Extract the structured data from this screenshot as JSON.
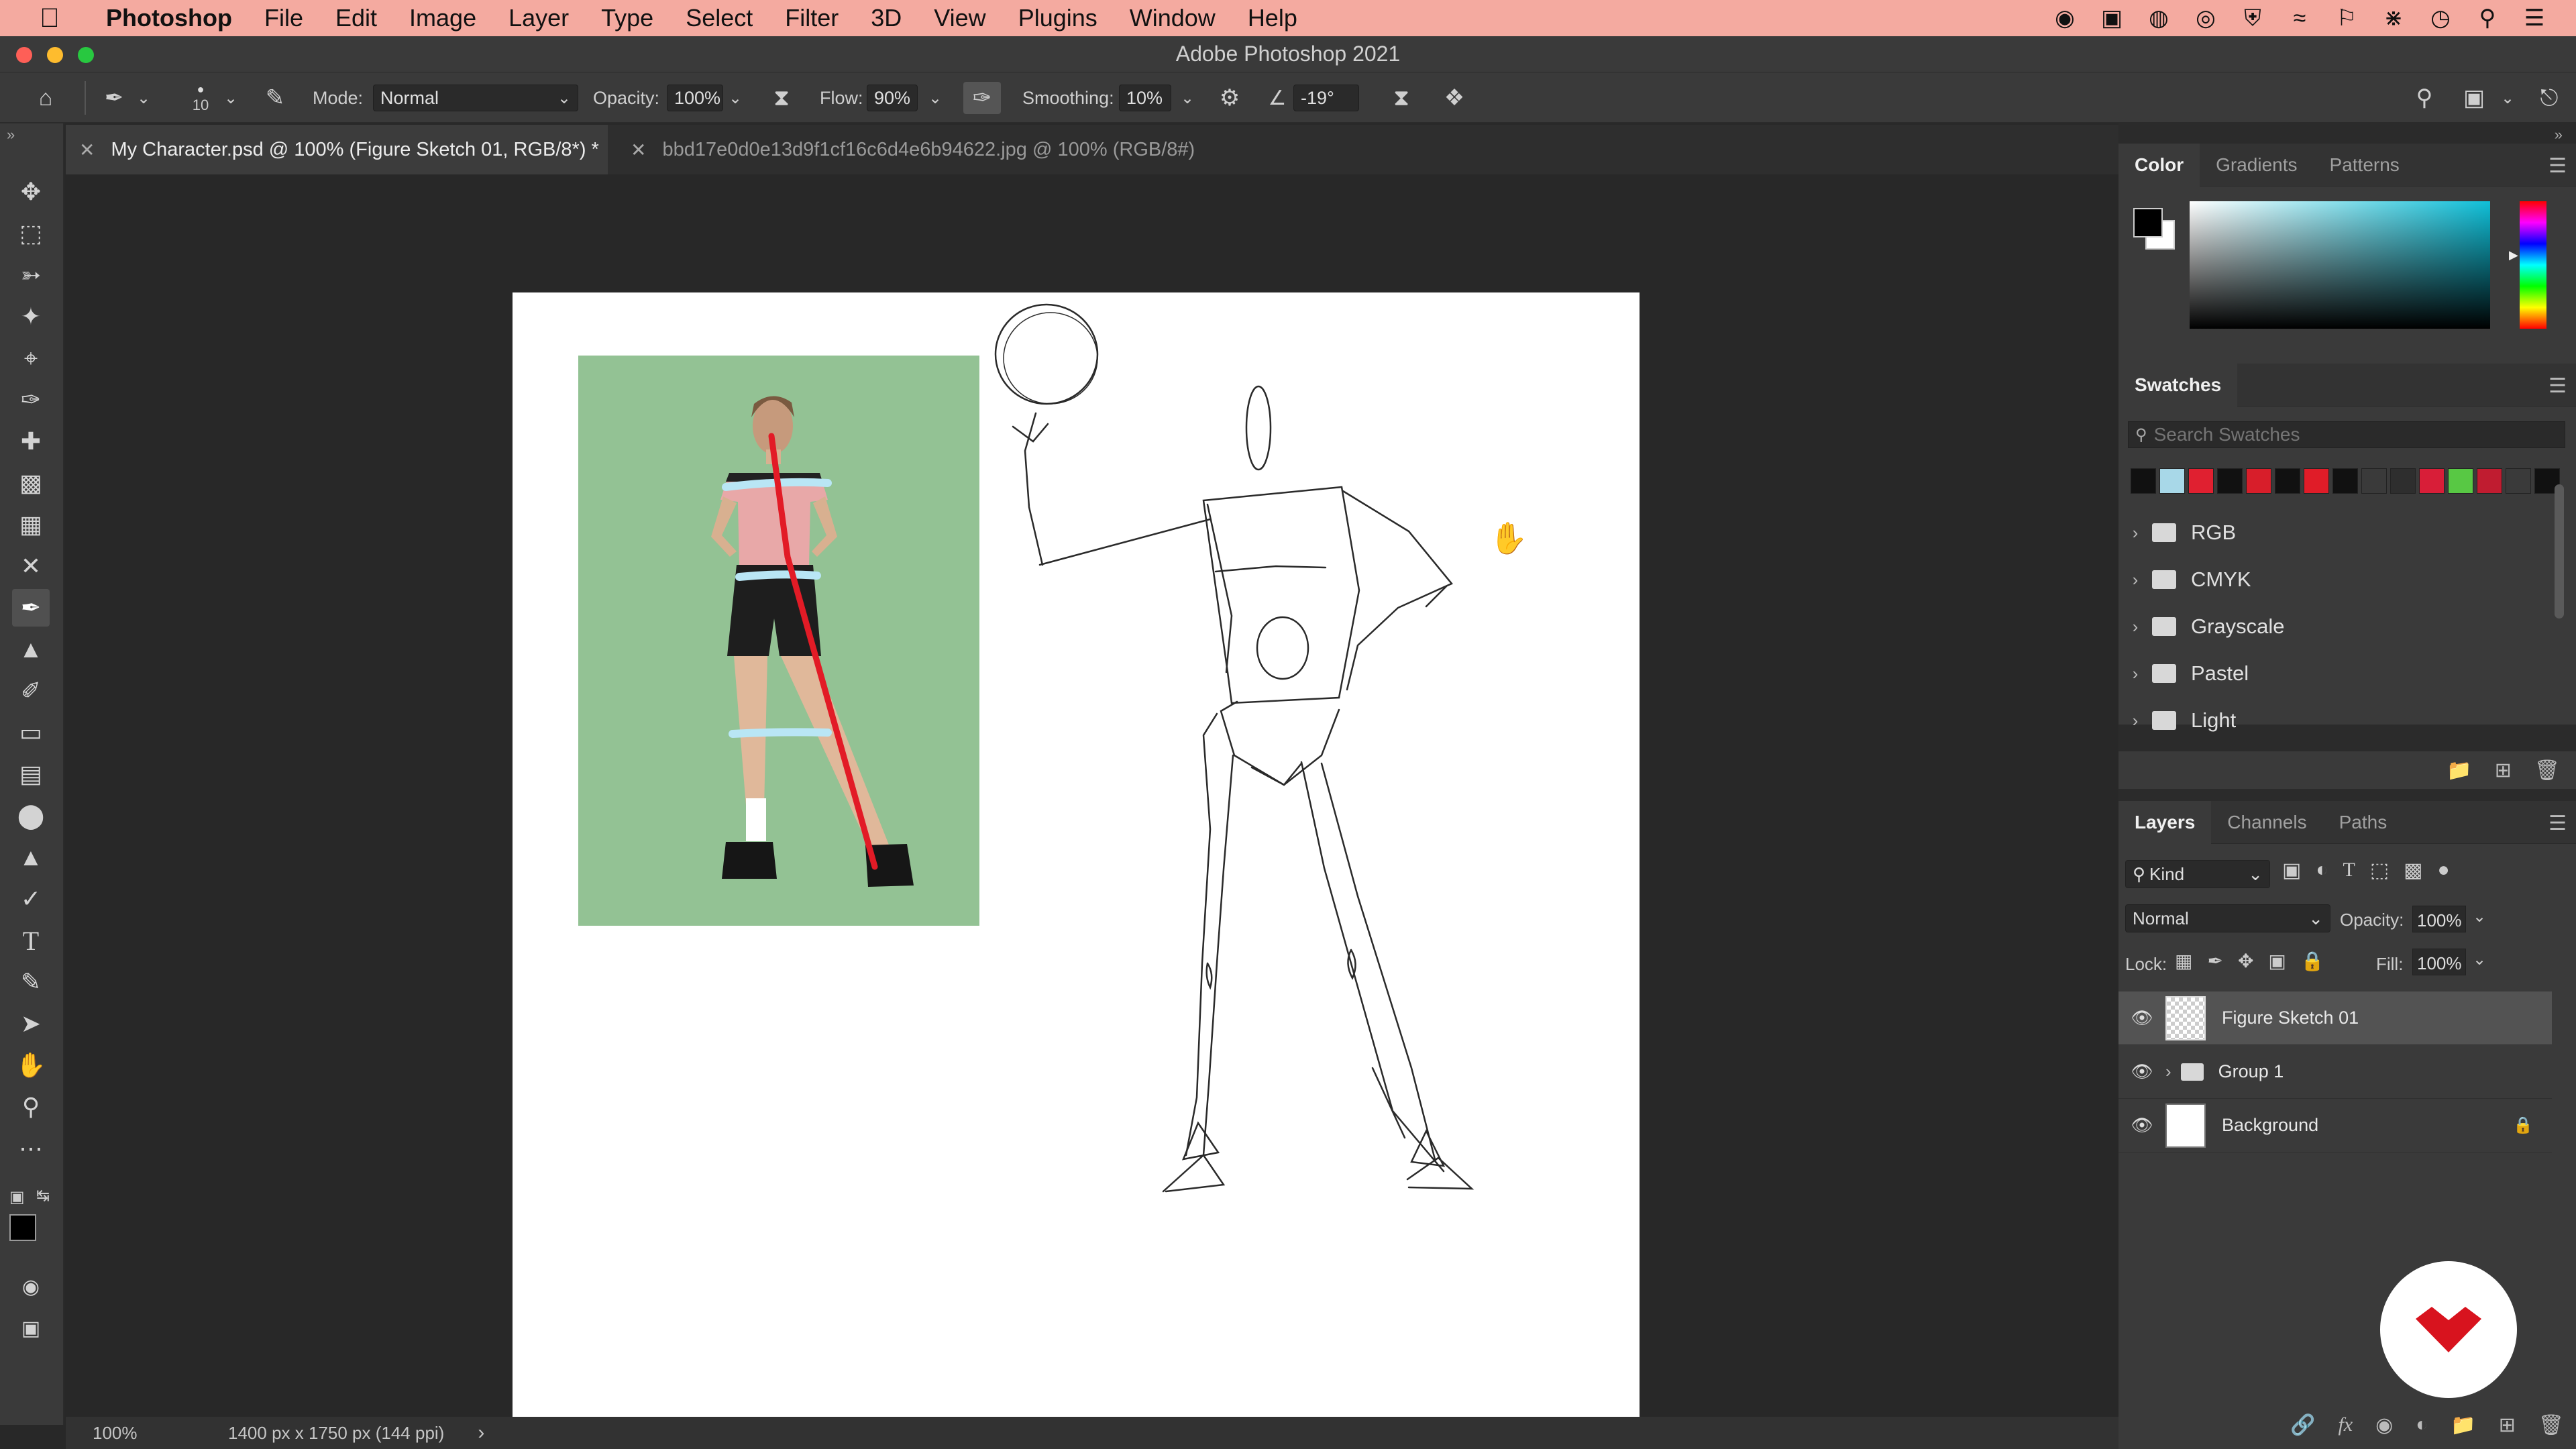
{
  "menubar": {
    "app_name": "Photoshop",
    "items": [
      "File",
      "Edit",
      "Image",
      "Layer",
      "Type",
      "Select",
      "Filter",
      "3D",
      "View",
      "Plugins",
      "Window",
      "Help"
    ]
  },
  "window": {
    "title": "Adobe Photoshop 2021"
  },
  "options": {
    "brush_size": "10",
    "mode_label": "Mode:",
    "mode_value": "Normal",
    "opacity_label": "Opacity:",
    "opacity_value": "100%",
    "flow_label": "Flow:",
    "flow_value": "90%",
    "smoothing_label": "Smoothing:",
    "smoothing_value": "10%",
    "angle_value": "-19°"
  },
  "tabs": [
    {
      "label": "My Character.psd @ 100% (Figure Sketch 01, RGB/8*) *",
      "active": true
    },
    {
      "label": "bbd17e0d0e13d9f1cf16c6d4e6b94622.jpg @ 100% (RGB/8#)",
      "active": false
    }
  ],
  "status": {
    "zoom": "100%",
    "doc_info": "1400 px x 1750 px (144 ppi)",
    "arrow": "›"
  },
  "color_panel": {
    "tabs": [
      "Color",
      "Gradients",
      "Patterns"
    ]
  },
  "swatches_panel": {
    "title": "Swatches",
    "search_placeholder": "Search Swatches",
    "colors": [
      "#111111",
      "#a8d8e8",
      "#e02030",
      "#111111",
      "#d81e2a",
      "#111111",
      "#e01c28",
      "#111111",
      "#3a3a3a",
      "#2e2e2e",
      "#d81e38",
      "#58c844",
      "#c01c30",
      "#3a3a3a",
      "#111111"
    ],
    "groups": [
      "RGB",
      "CMYK",
      "Grayscale",
      "Pastel",
      "Light"
    ]
  },
  "layers_panel": {
    "tabs": [
      "Layers",
      "Channels",
      "Paths"
    ],
    "filter_label": "Kind",
    "blend_mode": "Normal",
    "opacity_label": "Opacity:",
    "opacity_value": "100%",
    "lock_label": "Lock:",
    "fill_label": "Fill:",
    "fill_value": "100%",
    "layers": [
      {
        "name": "Figure Sketch 01",
        "selected": true
      },
      {
        "name": "Group 1",
        "selected": false
      },
      {
        "name": "Background",
        "selected": false
      }
    ]
  }
}
